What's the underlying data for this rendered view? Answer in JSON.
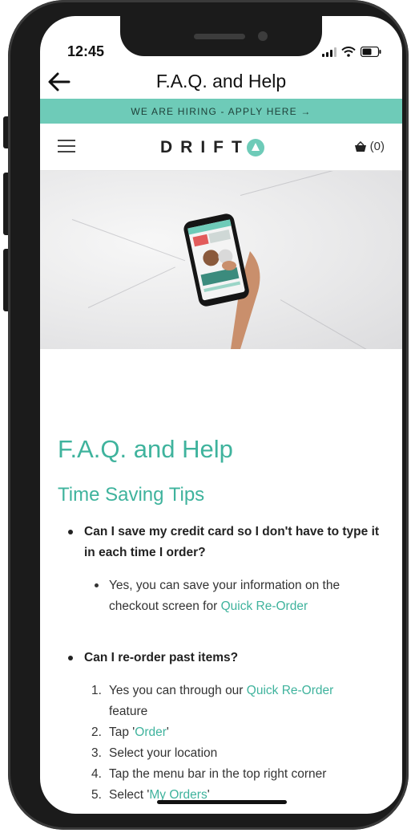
{
  "status_bar": {
    "time": "12:45"
  },
  "nav": {
    "title": "F.A.Q. and Help"
  },
  "banner": {
    "text": "WE ARE HIRING - APPLY HERE →"
  },
  "site_header": {
    "logo": "DRIFT",
    "cart_count": "(0)"
  },
  "page": {
    "heading": "F.A.Q. and Help",
    "section_title": "Time Saving Tips",
    "q1": {
      "question": "Can I save my credit card so I don't have to type it in each time I order?",
      "answer_text": "Yes, you can save your information on the checkout screen for ",
      "answer_link": "Quick Re-Order"
    },
    "q2": {
      "question": "Can I re-order past items?",
      "steps": [
        {
          "num": "1.",
          "pre": "Yes you can through our ",
          "link": "Quick Re-Order",
          "post": " feature"
        },
        {
          "num": "2.",
          "pre": "Tap '",
          "link": "Order",
          "post": "'"
        },
        {
          "num": "3.",
          "pre": "Select your location",
          "link": "",
          "post": ""
        },
        {
          "num": "4.",
          "pre": "Tap the menu bar in the top right corner",
          "link": "",
          "post": ""
        },
        {
          "num": "5.",
          "pre": "Select '",
          "link": "My Orders",
          "post": "'"
        }
      ]
    }
  },
  "colors": {
    "accent": "#3fb39d",
    "banner": "#6ecbb8",
    "frame": "#1b1b1b"
  }
}
